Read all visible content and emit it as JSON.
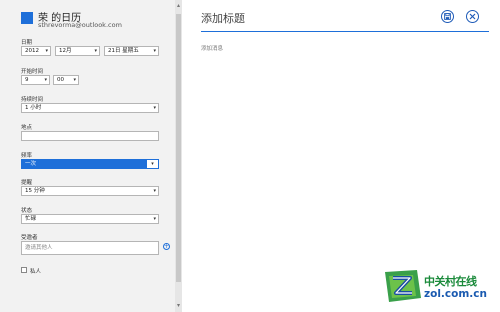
{
  "calendar": {
    "name": "荣 的日历",
    "email": "sthrevorma@outlook.com",
    "color": "#1e6fd9"
  },
  "form": {
    "date_label": "日期",
    "date_year": "2012",
    "date_month": "12月",
    "date_day": "21日 星期五",
    "start_label": "开始时间",
    "start_hour": "9",
    "start_minute": "00",
    "duration_label": "持续时间",
    "duration_value": "1 小时",
    "location_label": "地点",
    "location_value": "",
    "repeat_label": "频率",
    "repeat_value": "一次",
    "reminder_label": "提醒",
    "reminder_value": "15 分钟",
    "status_label": "状态",
    "status_value": "忙碌",
    "attendees_label": "受邀者",
    "attendees_placeholder": "邀请其他人",
    "private_label": "私人"
  },
  "detail": {
    "title_placeholder": "添加标题",
    "message_placeholder": "添加消息"
  },
  "watermark": {
    "cn": "中关村在线",
    "url": "zol.com.cn"
  },
  "colors": {
    "accent": "#1e6fd9",
    "button": "#1e5bb8",
    "left_panel": "#f2f2f2"
  }
}
